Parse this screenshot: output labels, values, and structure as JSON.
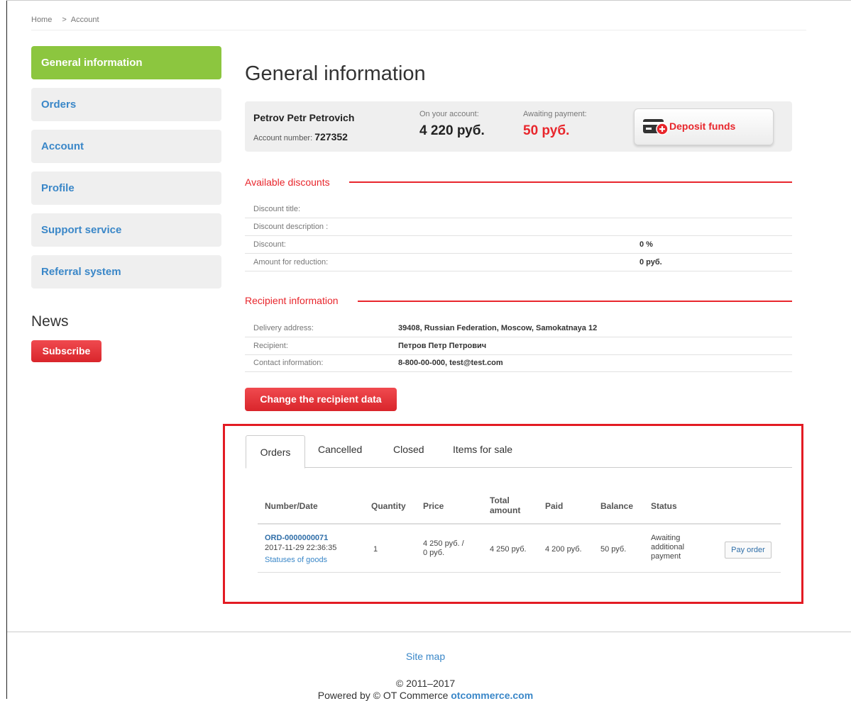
{
  "breadcrumb": {
    "home": "Home",
    "separator": ">",
    "current": "Account"
  },
  "sidebar": {
    "items": [
      {
        "label": "General information",
        "active": true
      },
      {
        "label": "Orders",
        "active": false
      },
      {
        "label": "Account",
        "active": false
      },
      {
        "label": "Profile",
        "active": false
      },
      {
        "label": "Support service",
        "active": false
      },
      {
        "label": "Referral system",
        "active": false
      }
    ],
    "news_title": "News",
    "subscribe_label": "Subscribe"
  },
  "main": {
    "title": "General information",
    "account": {
      "name": "Petrov Petr Petrovich",
      "number_label": "Account number:",
      "number": "727352",
      "balance_label": "On your account:",
      "balance": "4 220 руб.",
      "awaiting_label": "Awaiting payment:",
      "awaiting": "50 руб.",
      "deposit_label": "Deposit funds"
    },
    "discounts": {
      "heading": "Available discounts",
      "rows": [
        {
          "label": "Discount title:",
          "value": ""
        },
        {
          "label": "Discount description :",
          "value": ""
        },
        {
          "label": "Discount:",
          "value": "0 %"
        },
        {
          "label": "Amount for reduction:",
          "value": "0 руб."
        }
      ]
    },
    "recipient": {
      "heading": "Recipient information",
      "rows": [
        {
          "label": "Delivery address:",
          "value": "39408, Russian Federation, Moscow, Samokatnaya 12"
        },
        {
          "label": "Recipient:",
          "value": "Петров Петр Петрович"
        },
        {
          "label": "Contact information:",
          "value": "8-800-00-000, test@test.com"
        }
      ],
      "change_label": "Change the recipient data"
    },
    "orders": {
      "tabs": [
        "Orders",
        "Cancelled",
        "Closed",
        "Items for sale"
      ],
      "columns": {
        "number_date": "Number/Date",
        "quantity": "Quantity",
        "price": "Price",
        "total_1": "Total",
        "total_2": "amount",
        "paid": "Paid",
        "balance": "Balance",
        "status": "Status"
      },
      "rows": [
        {
          "number": "ORD-0000000071",
          "date": "2017-11-29 22:36:35",
          "statuses_link": "Statuses of goods",
          "quantity": "1",
          "price_1": "4 250 руб. /",
          "price_2": "0 руб.",
          "total": "4 250 руб.",
          "paid": "4 200 руб.",
          "balance": "50 руб.",
          "status_1": "Awaiting",
          "status_2": "additional",
          "status_3": "payment",
          "pay_label": "Pay order"
        }
      ]
    }
  },
  "footer": {
    "sitemap": "Site map",
    "copyright": "© 2011–2017",
    "powered_prefix": "Powered by © OT Commerce",
    "powered_link": "otcommerce.com"
  },
  "colors": {
    "accent_green": "#8cc63f",
    "accent_red": "#e8262c",
    "link_blue": "#3a87c8"
  }
}
